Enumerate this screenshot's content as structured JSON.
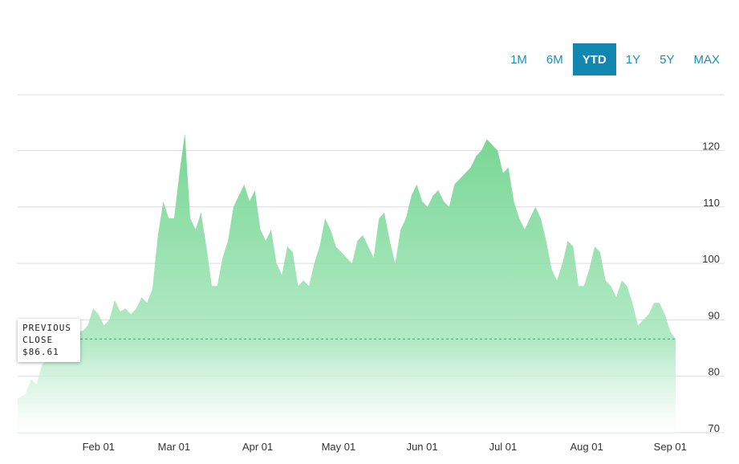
{
  "range_selector": {
    "options": [
      "1M",
      "6M",
      "YTD",
      "1Y",
      "5Y",
      "MAX"
    ],
    "active": "YTD",
    "accent_color": "#1086b0"
  },
  "tooltip": {
    "line1": "PREVIOUS",
    "line2": "CLOSE",
    "value": "$86.61"
  },
  "chart_data": {
    "type": "area",
    "previous_close": 86.61,
    "ylim": [
      70,
      124
    ],
    "y_ticks": [
      70,
      80,
      90,
      100,
      110,
      120
    ],
    "x_ticks": [
      {
        "label": "Feb 01",
        "x": 31
      },
      {
        "label": "Mar 01",
        "x": 59
      },
      {
        "label": "Apr 01",
        "x": 90
      },
      {
        "label": "May 01",
        "x": 120
      },
      {
        "label": "Jun 01",
        "x": 151
      },
      {
        "label": "Jul 01",
        "x": 181
      },
      {
        "label": "Aug 01",
        "x": 212
      },
      {
        "label": "Sep 01",
        "x": 243
      }
    ],
    "x_unit": "day of year",
    "xlim": [
      1,
      245
    ],
    "fill_color": "#7fd99a",
    "grid": true,
    "series": [
      {
        "x": [
          1,
          4,
          6,
          8,
          10,
          12,
          14,
          16,
          18,
          20,
          23,
          25,
          27,
          29,
          31,
          33,
          35,
          37,
          39,
          41,
          43,
          45,
          47,
          49,
          51,
          53,
          55,
          57,
          59,
          61,
          63,
          65,
          67,
          69,
          71,
          73,
          75,
          77,
          79,
          81,
          83,
          85,
          87,
          89,
          91,
          93,
          95,
          97,
          99,
          101,
          103,
          105,
          107,
          109,
          111,
          113,
          115,
          117,
          119,
          121,
          123,
          125,
          127,
          129,
          131,
          133,
          135,
          137,
          139,
          141,
          143,
          145,
          147,
          149,
          151,
          153,
          155,
          157,
          159,
          161,
          163,
          165,
          167,
          169,
          171,
          173,
          175,
          177,
          179,
          181,
          183,
          185,
          187,
          189,
          191,
          193,
          195,
          197,
          199,
          201,
          203,
          205,
          207,
          209,
          211,
          213,
          215,
          217,
          219,
          221,
          223,
          225,
          227,
          229,
          231,
          233,
          235,
          237,
          239,
          241,
          243,
          245
        ],
        "values": [
          76,
          77,
          79.5,
          78.5,
          82,
          83,
          84,
          85,
          86,
          87,
          88,
          88,
          89,
          92,
          91,
          89,
          90,
          93.5,
          91.5,
          92,
          91,
          92,
          94,
          93,
          95.5,
          105,
          111,
          108,
          108,
          116,
          123,
          108,
          106,
          109,
          103,
          96,
          96,
          101,
          104,
          110,
          112,
          114,
          111,
          113,
          106,
          104,
          106,
          100,
          98,
          103,
          102,
          96,
          97,
          96,
          100,
          103,
          108,
          106,
          103,
          102,
          101,
          100,
          104,
          105,
          103,
          101,
          108,
          109,
          104,
          100,
          106,
          108,
          112,
          114,
          111,
          110,
          112,
          113,
          111,
          110,
          114,
          115,
          116,
          117,
          119,
          120,
          122,
          121,
          120,
          116,
          117,
          111,
          108,
          106,
          108,
          110,
          108,
          104,
          99,
          97,
          100,
          104,
          103,
          96,
          96,
          99,
          103,
          102,
          97,
          96,
          94,
          97,
          96,
          93,
          89,
          90,
          91,
          93,
          93,
          91,
          88,
          86.61
        ]
      }
    ]
  }
}
